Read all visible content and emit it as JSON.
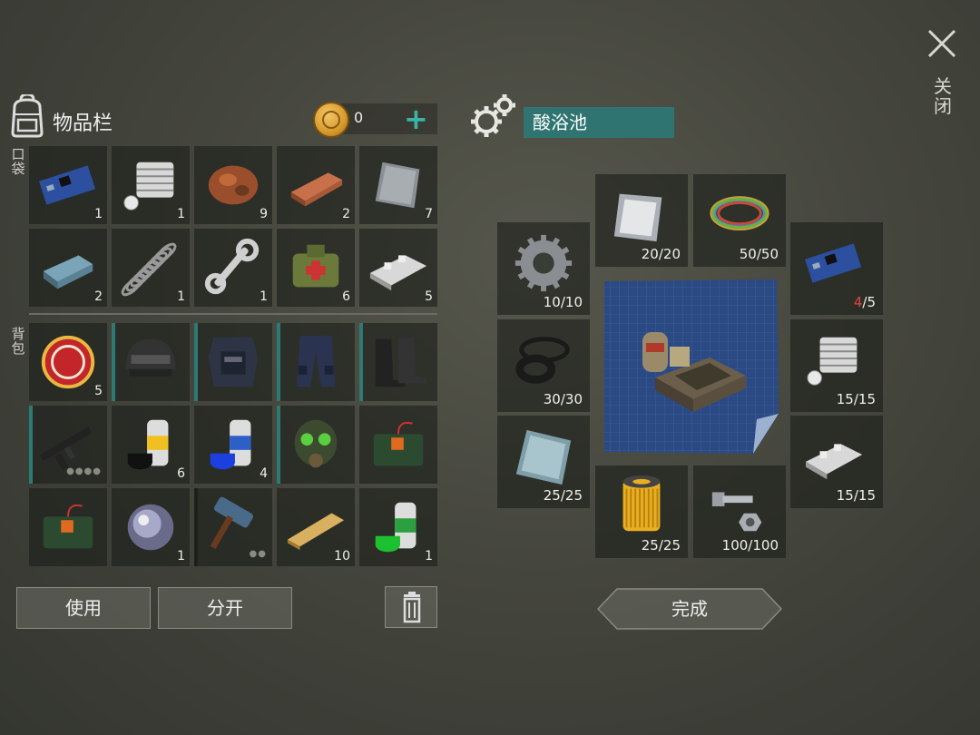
{
  "close": {
    "label": "关闭"
  },
  "inventory": {
    "title": "物品栏",
    "coins": "0",
    "plus": "+",
    "pockets_label": "口袋",
    "backpack_label": "背包",
    "pockets": [
      {
        "icon": "circuit-board-icon",
        "qty": "1"
      },
      {
        "icon": "engine-cylinder-icon",
        "qty": "1"
      },
      {
        "icon": "copper-ore-icon",
        "qty": "9"
      },
      {
        "icon": "copper-ingot-icon",
        "qty": "2"
      },
      {
        "icon": "iron-plate-icon",
        "qty": "7"
      },
      {
        "icon": "steel-ingot-icon",
        "qty": "2"
      },
      {
        "icon": "spring-icon",
        "qty": "1"
      },
      {
        "icon": "wrench-icon",
        "qty": "1"
      },
      {
        "icon": "medkit-bag-icon",
        "qty": "6"
      },
      {
        "icon": "aluminum-bar-icon",
        "qty": "5"
      }
    ],
    "backpack": [
      {
        "icon": "bottle-cap-icon",
        "qty": "5",
        "equip": false
      },
      {
        "icon": "helmet-icon",
        "qty": "",
        "equip": true
      },
      {
        "icon": "body-armor-icon",
        "qty": "",
        "equip": true
      },
      {
        "icon": "armored-pants-icon",
        "qty": "",
        "equip": true
      },
      {
        "icon": "boots-icon",
        "qty": "",
        "equip": true
      },
      {
        "icon": "assault-rifle-icon",
        "qty": "",
        "equip": true,
        "dots": "●●●●"
      },
      {
        "icon": "black-spray-paint-icon",
        "qty": "6",
        "equip": false
      },
      {
        "icon": "blue-spray-paint-icon",
        "qty": "4",
        "equip": false
      },
      {
        "icon": "gas-mask-icon",
        "qty": "",
        "equip": true
      },
      {
        "icon": "explosive-bundle-icon",
        "qty": "",
        "equip": false
      },
      {
        "icon": "explosive-bundle-icon",
        "qty": "",
        "equip": false
      },
      {
        "icon": "lens-icon",
        "qty": "1",
        "equip": false
      },
      {
        "icon": "sledgehammer-icon",
        "qty": "",
        "equip": false,
        "darkbar": true,
        "dots": "●●"
      },
      {
        "icon": "wooden-plank-icon",
        "qty": "10",
        "equip": false
      },
      {
        "icon": "green-spray-paint-icon",
        "qty": "1",
        "equip": false
      }
    ],
    "use_label": "使用",
    "split_label": "分开"
  },
  "crafting": {
    "title": "酸浴池",
    "done_label": "完成",
    "slots": [
      {
        "icon": "metal-sheet-icon",
        "have": "20",
        "need": "20"
      },
      {
        "icon": "wire-coil-icon",
        "have": "50",
        "need": "50"
      },
      {
        "icon": "gear-icon",
        "have": "10",
        "need": "10"
      },
      {
        "icon": "circuit-board-icon",
        "have": "4",
        "need": "5",
        "short": true
      },
      {
        "icon": "rubber-rings-icon",
        "have": "30",
        "need": "30"
      },
      {
        "icon": "engine-cylinder-icon",
        "have": "15",
        "need": "15"
      },
      {
        "icon": "glass-sheet-icon",
        "have": "25",
        "need": "25"
      },
      {
        "icon": "aluminum-bar-icon",
        "have": "15",
        "need": "15"
      },
      {
        "icon": "oil-filter-icon",
        "have": "25",
        "need": "25"
      },
      {
        "icon": "bolt-nut-icon",
        "have": "100",
        "need": "100"
      }
    ],
    "blueprint": {
      "icon": "acid-bath-blueprint-icon"
    }
  },
  "colors": {
    "accent_teal": "#2f7470",
    "plus_teal": "#3bb2a4",
    "shortage_red": "#e0453c",
    "cell_bg": "#1c1e1a"
  }
}
